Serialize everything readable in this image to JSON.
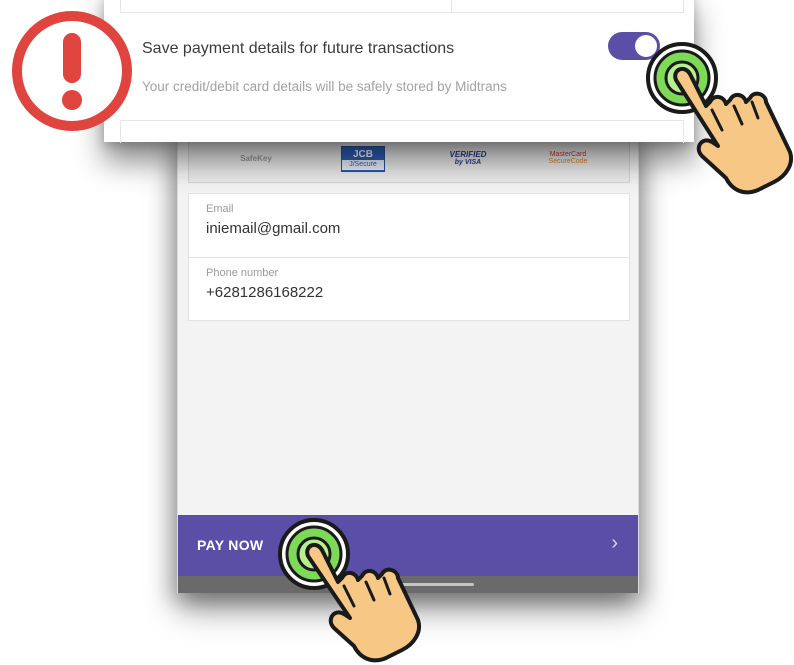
{
  "payment_logos": {
    "safekey": "SafeKey",
    "jcb_top": "JCB",
    "jcb_bottom": "J/Secure",
    "visa_top": "VERIFIED",
    "visa_bottom": "by VISA",
    "mastercard_top": "MasterCard",
    "mastercard_bottom": "SecureCode"
  },
  "contact": {
    "email_label": "Email",
    "email_value": "iniemail@gmail.com",
    "phone_label": "Phone number",
    "phone_value": "+6281286168222"
  },
  "pay_button": {
    "label": "PAY NOW",
    "chevron": "›"
  },
  "save_payment": {
    "title": "Save payment details for future transactions",
    "description": "Your credit/debit card details will be safely stored by Midtrans",
    "toggle_on": true
  },
  "colors": {
    "accent": "#5b4ea6",
    "alert": "#e0443e",
    "tap_ring": "#7ed957",
    "hand_skin": "#f7c785"
  },
  "icons": {
    "alert": "exclamation-circle-icon",
    "tap_hand": "tap-hand-icon",
    "chevron": "chevron-right-icon"
  }
}
